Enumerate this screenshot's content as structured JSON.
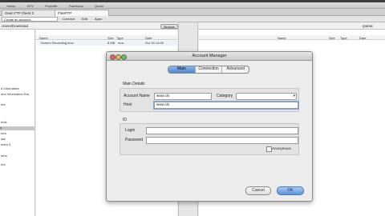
{
  "browser": {
    "bookmarks": [
      "Yahoo",
      "NTV",
      "PhotoBit",
      "Facebook",
      "Quran"
    ],
    "tabs": [
      "Gear FTP Client 3",
      "FineFTP"
    ]
  },
  "toolbar": {
    "url_text": "Create an account...",
    "buttons": [
      "Connect",
      "Edit",
      "Apps"
    ]
  },
  "local": {
    "path": "Users/Download",
    "browse_label": "Browse",
    "columns": [
      "Name",
      "Size",
      "Type",
      "Date"
    ],
    "files": [
      {
        "name": "Screen Recording.mov",
        "size": "8 MB",
        "type": "mov",
        "date": "Oct 16 14:05"
      }
    ]
  },
  "sidebar": {
    "items": [
      "d Information",
      "and Information Eta",
      "ers",
      "ents",
      "d",
      "rers",
      "ash",
      "ment 3",
      "ders",
      "ent"
    ]
  },
  "remote": {
    "path_right": "/public",
    "columns": [
      "Name",
      "Size",
      "Type",
      "Date"
    ]
  },
  "dialog": {
    "title": "Account Manager",
    "tabs": [
      "Main",
      "Connection",
      "Advanced"
    ],
    "active_tab": "Main",
    "main_details": {
      "heading": "Main Details",
      "account_name_label": "Account Name",
      "account_name_value": "www.cls",
      "category_label": "Category",
      "category_value": "",
      "host_label": "Host",
      "host_value": "www.cls"
    },
    "id_section": {
      "heading": "ID",
      "login_label": "Login",
      "login_value": "",
      "password_label": "Password",
      "password_value": "",
      "anonymous_label": "Anonymous",
      "anonymous_checked": false
    },
    "cancel_label": "Cancel",
    "ok_label": "OK"
  }
}
